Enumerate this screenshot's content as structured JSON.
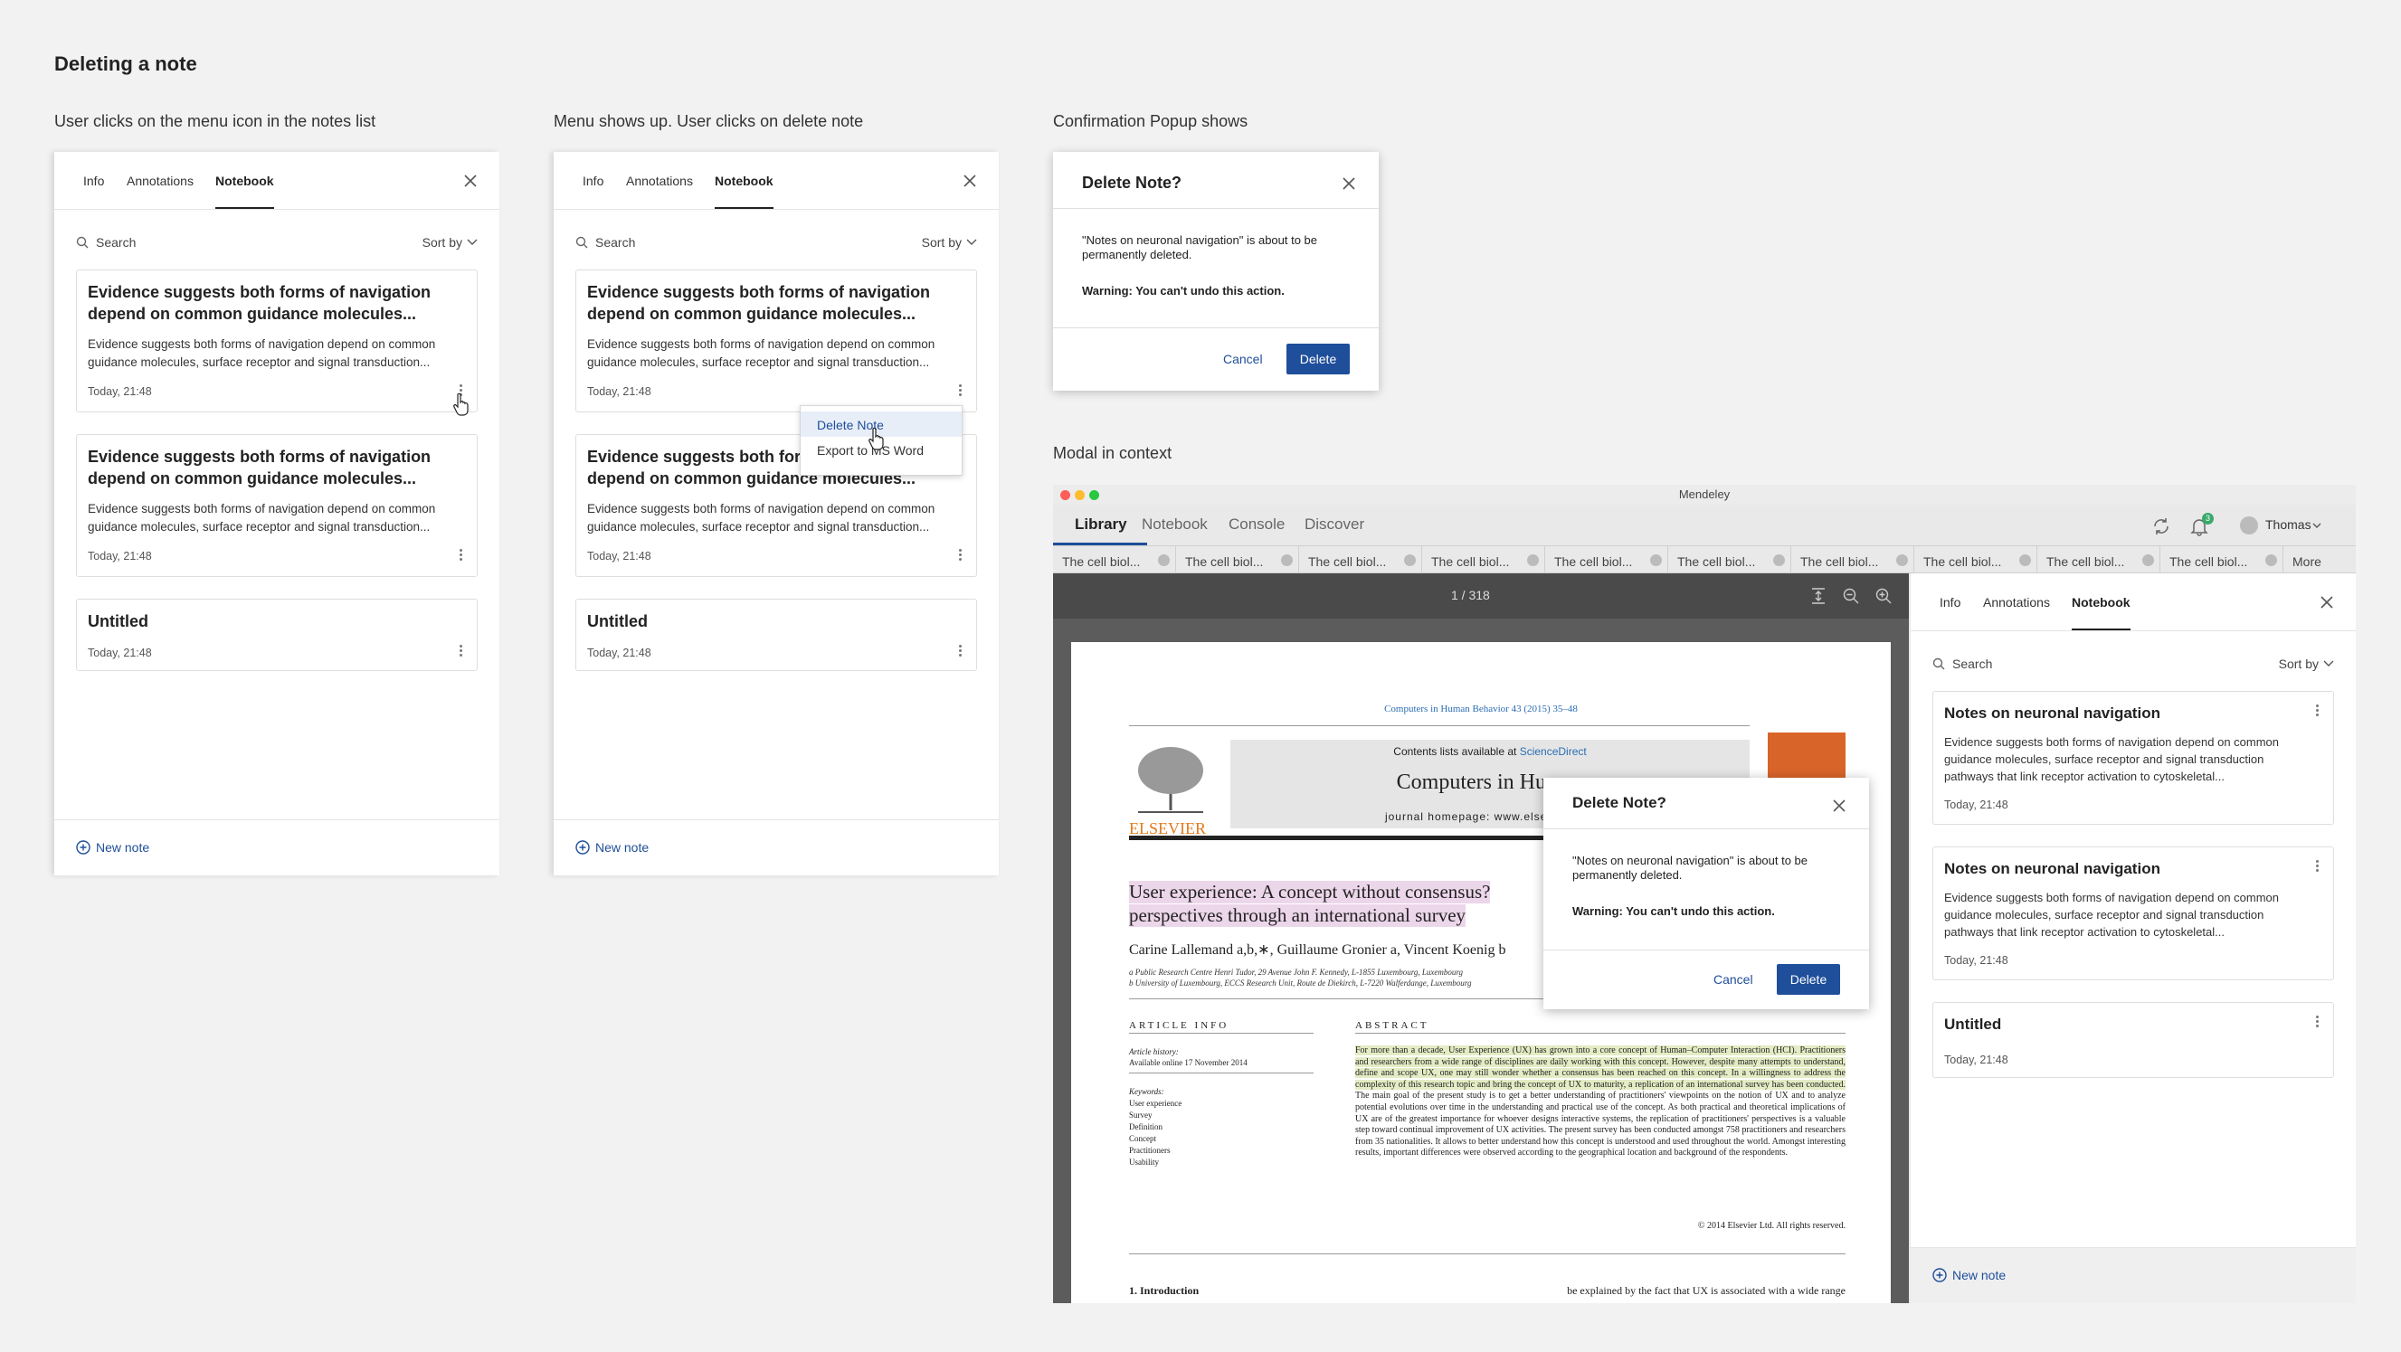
{
  "heading": "Deleting a note",
  "captions": {
    "step1": "User clicks on the menu icon in the notes list",
    "step2": "Menu shows up. User clicks on delete note",
    "step3": "Confirmation Popup shows",
    "step4": "Modal in context"
  },
  "panel": {
    "tabs": [
      "Info",
      "Annotations",
      "Notebook"
    ],
    "search_placeholder": "Search",
    "sort_label": "Sort by",
    "new_note": "New note",
    "notes": [
      {
        "title": "Evidence suggests both forms of navigation depend on common guidance molecules...",
        "body": "Evidence suggests both forms of navigation depend on common guidance molecules, surface receptor and signal transduction...",
        "date": "Today, 21:48"
      },
      {
        "title": "Evidence suggests both forms of navigation depend on common guidance molecules...",
        "body": "Evidence suggests both forms of navigation depend on common guidance molecules, surface receptor and signal transduction...",
        "date": "Today, 21:48"
      },
      {
        "title": "Untitled",
        "date": "Today, 21:48"
      }
    ]
  },
  "menu": {
    "delete": "Delete Note",
    "export": "Export to MS Word"
  },
  "dialog": {
    "title": "Delete Note?",
    "message": "\"Notes on neuronal navigation\" is about to be permanently deleted.",
    "warning": "Warning: You can't undo this action.",
    "cancel": "Cancel",
    "delete": "Delete"
  },
  "app": {
    "window_title": "Mendeley",
    "nav": [
      "Library",
      "Notebook",
      "Console",
      "Discover"
    ],
    "user": "Thomas",
    "notification_count": "3",
    "doc_tab_label": "The cell biol...",
    "more_tab": "More",
    "page_indicator": "1 / 318",
    "side_notes": [
      {
        "title": "Notes on neuronal navigation",
        "body": "Evidence suggests both forms of navigation depend on common guidance molecules, surface receptor and signal transduction pathways that link receptor activation to cytoskeletal...",
        "date": "Today, 21:48"
      },
      {
        "title": "Notes on neuronal navigation",
        "body": "Evidence suggests both forms of navigation depend on common guidance molecules, surface receptor and signal transduction pathways that link receptor activation to cytoskeletal...",
        "date": "Today, 21:48"
      },
      {
        "title": "Untitled",
        "date": "Today, 21:48"
      }
    ]
  },
  "paper": {
    "citation": "Computers in Human Behavior 43 (2015) 35–48",
    "contents_prefix": "Contents lists available at ",
    "contents_link": "ScienceDirect",
    "journal": "Computers in Human",
    "homepage": "journal homepage: www.elsevier.com",
    "publisher": "ELSEVIER",
    "title_line1": "User experience: A concept without consensus?",
    "title_line2": "perspectives through an international survey",
    "authors": "Carine Lallemand a,b,∗, Guillaume Gronier a, Vincent Koenig b",
    "affil_a": "a Public Research Centre Henri Tudor, 29 Avenue John F. Kennedy, L-1855 Luxembourg, Luxembourg",
    "affil_b": "b University of Luxembourg, ECCS Research Unit, Route de Diekirch, L-7220 Walferdange, Luxembourg",
    "article_info_heading": "ARTICLE INFO",
    "abstract_heading": "ABSTRACT",
    "history_label": "Article history:",
    "history": "Available online 17 November 2014",
    "keywords_label": "Keywords:",
    "keywords": [
      "User experience",
      "Survey",
      "Definition",
      "Concept",
      "Practitioners",
      "Usability"
    ],
    "abstract_hl": "For more than a decade, User Experience (UX) has grown into a core concept of Human–Computer Interaction (HCI). Practitioners and researchers from a wide range of disciplines are daily working with this concept. However, despite many attempts to understand, define and scope UX, one may still wonder whether a consensus has been reached on this concept. In a willingness to address the complexity of this research topic and bring the concept of UX to maturity, a replication of an international survey has been conducted.",
    "abstract_rest": " The main goal of the present study is to get a better understanding of practitioners' viewpoints on the notion of UX and to analyze potential evolutions over time in the understanding and practical use of the concept. As both practical and theoretical implications of UX are of the greatest importance for whoever designs interactive systems, the replication of practitioners' perspectives is a valuable step toward continual improvement of UX activities. The present survey has been conducted amongst 758 practitioners and researchers from 35 nationalities. It allows to better understand how this concept is understood and used throughout the world. Amongst interesting results, important differences were observed according to the geographical location and background of the respondents.",
    "copyright": "© 2014 Elsevier Ltd. All rights reserved.",
    "intro_heading": "1. Introduction",
    "intro_text": "be explained by the fact that UX is associated with a wide range"
  },
  "colors": {
    "accent": "#1f4e9a",
    "highlight": "#e3ecc4",
    "title_highlight": "#ecd6ea"
  }
}
